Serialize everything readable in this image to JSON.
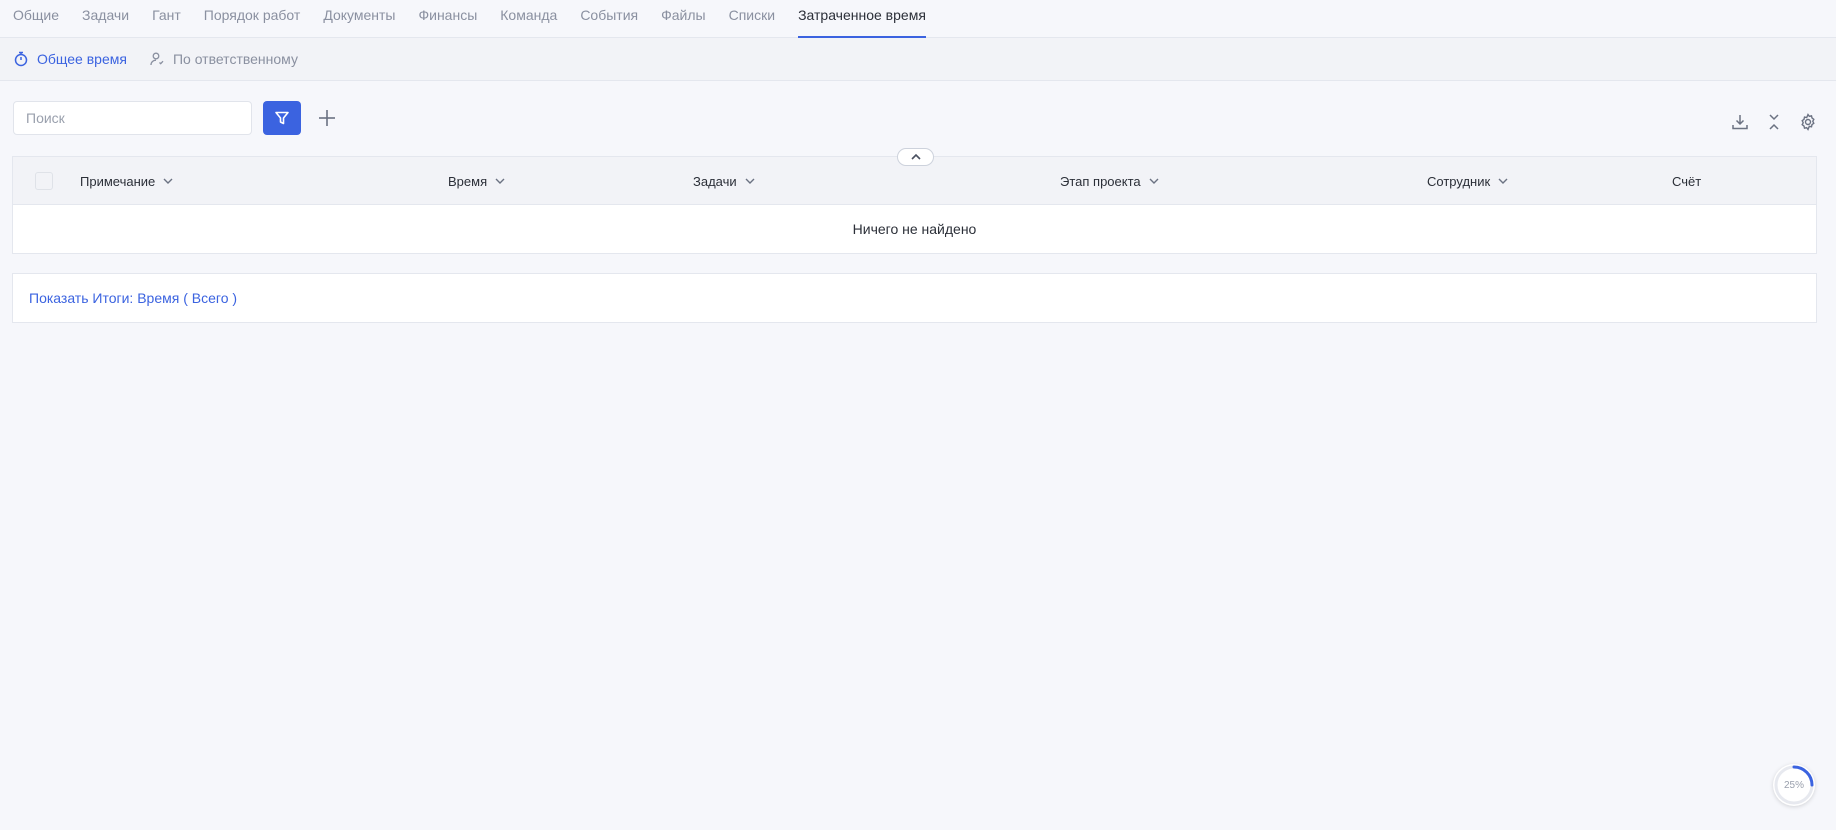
{
  "tabs": [
    {
      "label": "Общие"
    },
    {
      "label": "Задачи"
    },
    {
      "label": "Гант"
    },
    {
      "label": "Порядок работ"
    },
    {
      "label": "Документы"
    },
    {
      "label": "Финансы"
    },
    {
      "label": "Команда"
    },
    {
      "label": "События"
    },
    {
      "label": "Файлы"
    },
    {
      "label": "Списки"
    },
    {
      "label": "Затраченное время",
      "active": true
    }
  ],
  "subtabs": [
    {
      "label": "Общее время",
      "icon": "stopwatch-icon",
      "active": true
    },
    {
      "label": "По ответственному",
      "icon": "user-icon",
      "active": false
    }
  ],
  "search": {
    "placeholder": "Поиск",
    "value": ""
  },
  "toolbar": {
    "filter_icon": "filter-icon",
    "add_icon": "plus-icon",
    "right_icons": [
      "download-icon",
      "collapse-icon",
      "gear-icon"
    ]
  },
  "table": {
    "columns": [
      "Примечание",
      "Время",
      "Задачи",
      "Этап проекта",
      "Сотрудник",
      "Счёт"
    ],
    "empty_text": "Ничего не найдено"
  },
  "totals": {
    "link_label": "Показать Итоги: Время ( Всего )"
  },
  "progress": {
    "value": 0.25,
    "label": "25%"
  },
  "colors": {
    "accent": "#3b63e0",
    "background": "#f6f7fb",
    "muted": "#8a90a0"
  }
}
